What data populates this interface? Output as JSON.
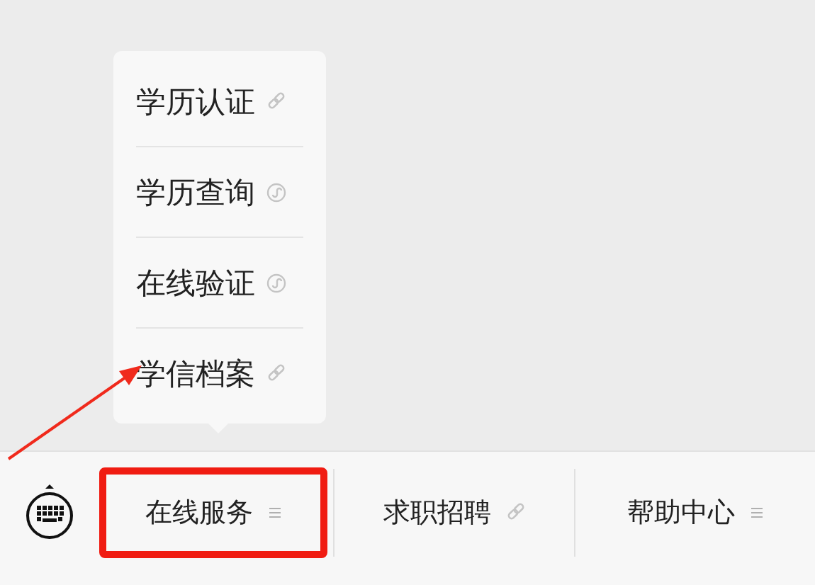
{
  "menu_bar": {
    "items": [
      {
        "label": "在线服务",
        "kind": "submenu",
        "highlighted": true,
        "expanded": true
      },
      {
        "label": "求职招聘",
        "kind": "link",
        "highlighted": false,
        "expanded": false
      },
      {
        "label": "帮助中心",
        "kind": "submenu",
        "highlighted": false,
        "expanded": false
      }
    ]
  },
  "submenu": {
    "items": [
      {
        "label": "学历认证",
        "kind": "link"
      },
      {
        "label": "学历查询",
        "kind": "miniprogram"
      },
      {
        "label": "在线验证",
        "kind": "miniprogram"
      },
      {
        "label": "学信档案",
        "kind": "link"
      }
    ]
  }
}
